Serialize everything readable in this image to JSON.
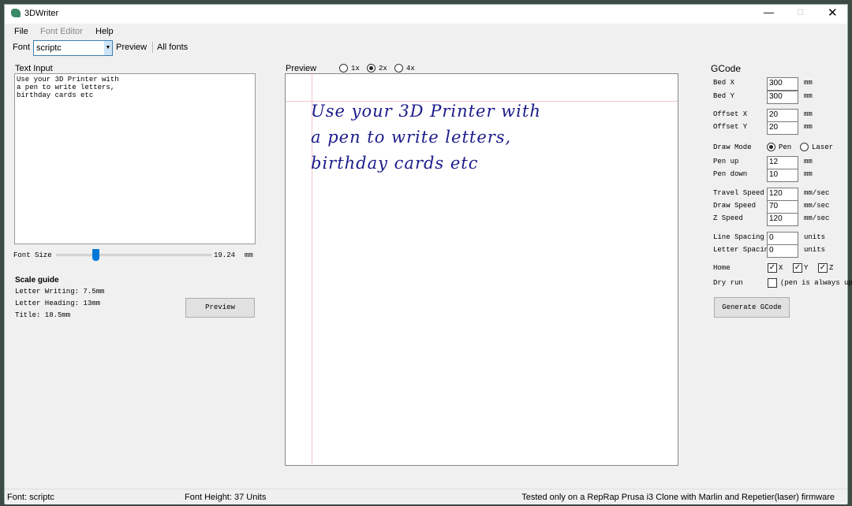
{
  "app": {
    "title": "3DWriter"
  },
  "menu": [
    "File",
    "Font Editor",
    "Help"
  ],
  "toolbar": {
    "font_label": "Font",
    "font_value": "scriptc",
    "preview": "Preview",
    "all_fonts": "All fonts"
  },
  "text_input": {
    "label": "Text Input",
    "lines": [
      "Use your 3D Printer with",
      "a pen to write letters,",
      "birthday cards etc"
    ]
  },
  "font_size": {
    "label": "Font Size",
    "value": "19.24",
    "unit": "mm",
    "slider_fraction": 0.26
  },
  "scale_guide": {
    "title": "Scale guide",
    "lines": [
      "Letter Writing: 7.5mm",
      "Letter Heading: 13mm",
      "Title: 18.5mm"
    ]
  },
  "preview_button": "Preview",
  "preview": {
    "label": "Preview",
    "zoom_options": [
      "1x",
      "2x",
      "4x"
    ],
    "selected": "2x",
    "ink_color": "#1a1a8c"
  },
  "gcode": {
    "title": "GCode",
    "bed_x": {
      "label": "Bed X",
      "value": "300",
      "unit": "mm"
    },
    "bed_y": {
      "label": "Bed Y",
      "value": "300",
      "unit": "mm"
    },
    "offset_x": {
      "label": "Offset X",
      "value": "20",
      "unit": "mm"
    },
    "offset_y": {
      "label": "Offset Y",
      "value": "20",
      "unit": "mm"
    },
    "draw_mode": {
      "label": "Draw Mode",
      "pen": "Pen",
      "laser": "Laser",
      "selected": "Pen"
    },
    "pen_up": {
      "label": "Pen up",
      "value": "12",
      "unit": "mm"
    },
    "pen_down": {
      "label": "Pen down",
      "value": "10",
      "unit": "mm"
    },
    "travel_speed": {
      "label": "Travel Speed",
      "value": "120",
      "unit": "mm/sec"
    },
    "draw_speed": {
      "label": "Draw Speed",
      "value": "70",
      "unit": "mm/sec"
    },
    "z_speed": {
      "label": "Z Speed",
      "value": "120",
      "unit": "mm/sec"
    },
    "line_spacing": {
      "label": "Line Spacing",
      "value": "0",
      "unit": "units"
    },
    "letter_spacing": {
      "label": "Letter Spacing",
      "value": "0",
      "unit": "units"
    },
    "home": {
      "label": "Home",
      "x": "X",
      "y": "Y",
      "z": "Z"
    },
    "dry_run": {
      "label": "Dry run",
      "note": "(pen is always up)"
    },
    "generate": "Generate GCode"
  },
  "status": {
    "font": "Font: scriptc",
    "height": "Font Height: 37 Units",
    "tested": "Tested only on a RepRap Prusa i3 Clone with Marlin and Repetier(laser) firmware"
  }
}
